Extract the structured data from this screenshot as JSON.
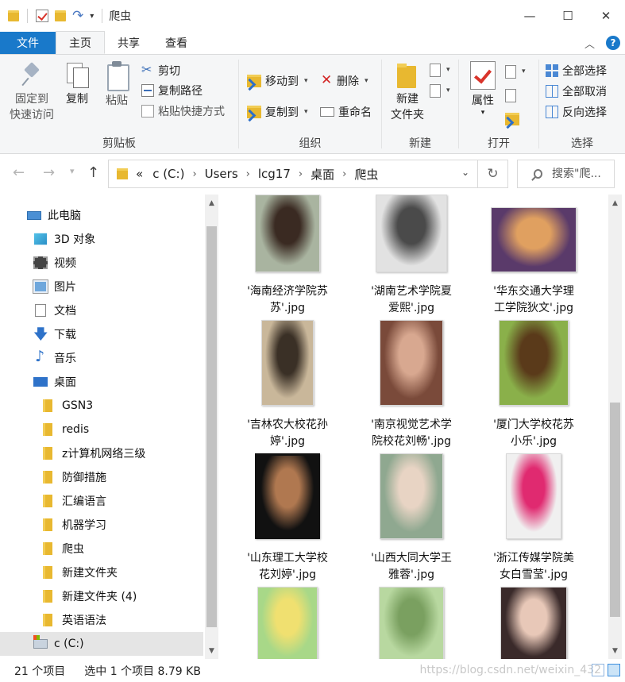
{
  "window": {
    "title": "爬虫",
    "minimize": "—",
    "maximize": "☐",
    "close": "✕"
  },
  "tabs": [
    {
      "label": "文件"
    },
    {
      "label": "主页"
    },
    {
      "label": "共享"
    },
    {
      "label": "查看"
    }
  ],
  "ribbon": {
    "clipboard": {
      "name": "剪贴板",
      "pin_line1": "固定到",
      "pin_line2": "快速访问",
      "copy": "复制",
      "paste": "粘贴",
      "cut": "剪切",
      "copy_path": "复制路径",
      "paste_shortcut": "粘贴快捷方式"
    },
    "organize": {
      "name": "组织",
      "move_to": "移动到",
      "copy_to": "复制到",
      "delete": "删除",
      "rename": "重命名"
    },
    "new": {
      "name": "新建",
      "new_folder_line1": "新建",
      "new_folder_line2": "文件夹"
    },
    "open": {
      "name": "打开",
      "properties": "属性"
    },
    "select": {
      "name": "选择",
      "select_all": "全部选择",
      "select_none": "全部取消",
      "invert": "反向选择"
    }
  },
  "address": {
    "prefix": "«",
    "crumbs": [
      "c (C:)",
      "Users",
      "lcg17",
      "桌面",
      "爬虫"
    ],
    "search_placeholder": "搜索\"爬..."
  },
  "nav_pane": {
    "items": [
      {
        "label": "此电脑",
        "icon": "computer-icon"
      },
      {
        "label": "3D 对象",
        "icon": "cube-icon"
      },
      {
        "label": "视频",
        "icon": "video-icon"
      },
      {
        "label": "图片",
        "icon": "pictures-icon"
      },
      {
        "label": "文档",
        "icon": "document-icon"
      },
      {
        "label": "下载",
        "icon": "download-icon"
      },
      {
        "label": "音乐",
        "icon": "music-icon"
      },
      {
        "label": "桌面",
        "icon": "desktop-icon"
      },
      {
        "label": "GSN3",
        "icon": "folder-icon"
      },
      {
        "label": "redis",
        "icon": "folder-icon"
      },
      {
        "label": "z计算机网络三级",
        "icon": "folder-icon"
      },
      {
        "label": "防御措施",
        "icon": "folder-icon"
      },
      {
        "label": "汇编语言",
        "icon": "folder-icon"
      },
      {
        "label": "机器学习",
        "icon": "folder-icon"
      },
      {
        "label": "爬虫",
        "icon": "folder-icon"
      },
      {
        "label": "新建文件夹",
        "icon": "folder-icon"
      },
      {
        "label": "新建文件夹 (4)",
        "icon": "folder-icon"
      },
      {
        "label": "英语语法",
        "icon": "folder-icon"
      },
      {
        "label": "c (C:)",
        "icon": "drive-icon"
      }
    ]
  },
  "files": [
    {
      "line1": "'海南经济学院苏",
      "line2": "苏'.jpg",
      "tone1": "#a9b4a0",
      "tone2": "#3a2a22"
    },
    {
      "line1": "'湖南艺术学院夏",
      "line2": "爱熙'.jpg",
      "tone1": "#e2e2e2",
      "tone2": "#4a4a4a"
    },
    {
      "line1": "'华东交通大学理",
      "line2": "工学院狄文'.jpg",
      "tone1": "#5a3a6a",
      "tone2": "#e0a060"
    },
    {
      "line1": "'吉林农大校花孙",
      "line2": "婷'.jpg",
      "tone1": "#c9b79a",
      "tone2": "#3a3026"
    },
    {
      "line1": "'南京视觉艺术学",
      "line2": "院校花刘畅'.jpg",
      "tone1": "#7a4a3a",
      "tone2": "#d8a890"
    },
    {
      "line1": "'厦门大学校花苏",
      "line2": "小乐'.jpg",
      "tone1": "#8ab04a",
      "tone2": "#5a3a1a"
    },
    {
      "line1": "'山东理工大学校",
      "line2": "花刘婷'.jpg",
      "tone1": "#111111",
      "tone2": "#b07850"
    },
    {
      "line1": "'山西大同大学王",
      "line2": "雅蓉'.jpg",
      "tone1": "#8fa890",
      "tone2": "#e8d4c4"
    },
    {
      "line1": "'浙江传媒学院美",
      "line2": "女白雪莹'.jpg",
      "tone1": "#f0f0f0",
      "tone2": "#e02a70"
    },
    {
      "line1": "",
      "line2": "",
      "tone1": "#a8d888",
      "tone2": "#f0e070"
    },
    {
      "line1": "",
      "line2": "",
      "tone1": "#b8d8a0",
      "tone2": "#7aa060"
    },
    {
      "line1": "",
      "line2": "",
      "tone1": "#3a2a2a",
      "tone2": "#e8c8b8"
    }
  ],
  "status": {
    "count": "21 个项目",
    "selected": "选中 1 个项目  8.79 KB",
    "watermark": "https://blog.csdn.net/weixin_432"
  }
}
